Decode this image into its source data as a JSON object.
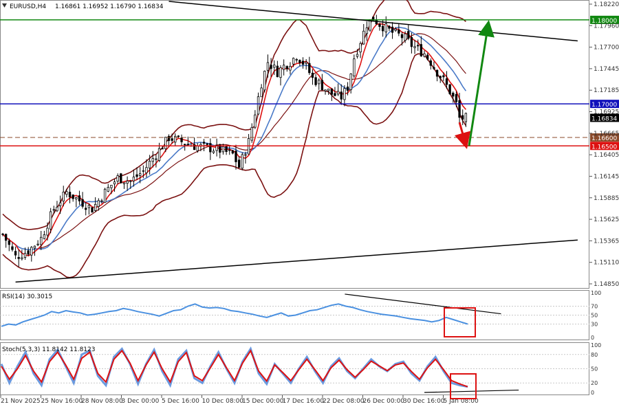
{
  "header": {
    "symbol": "EURUSD,H4",
    "ohlc": "1.16861 1.16952 1.16790 1.16834"
  },
  "colors": {
    "candle": "#000000",
    "bollinger": "#7a1010",
    "ma_fast": "#dd1111",
    "ma_slow": "#4a7ac8",
    "level_green": "#118811",
    "level_blue": "#1111bb",
    "level_red": "#dd1111",
    "level_dashed": "#8a4a2a",
    "rsi_line": "#4a90e0",
    "stoch_main": "#6a9ae0",
    "stoch_signal": "#dd1111",
    "box": "#dd1111",
    "arrow_up": "#118811",
    "arrow_down": "#dd1111",
    "trendline": "#000000"
  },
  "chart_data": [
    {
      "type": "candlestick",
      "pane": "price",
      "ylim": [
        1.1485,
        1.1822
      ],
      "price_axis_ticks": [
        "1.18220",
        "1.17960",
        "1.17700",
        "1.17445",
        "1.17185",
        "1.16925",
        "1.16665",
        "1.16405",
        "1.16145",
        "1.15885",
        "1.15625",
        "1.15365",
        "1.15110",
        "1.14850"
      ],
      "x_ticks": [
        "21 Nov 2025",
        "25 Nov 16:00",
        "28 Nov 08:00",
        "3 Dec 00:00",
        "5 Dec 16:00",
        "10 Dec 08:00",
        "15 Dec 00:00",
        "17 Dec 16:00",
        "22 Dec 08:00",
        "26 Dec 00:00",
        "30 Dec 16:00",
        "5 Jan 08:00"
      ],
      "horizontal_levels": [
        {
          "price": 1.18,
          "label": "1.18000",
          "style": "green"
        },
        {
          "price": 1.17,
          "label": "1.17000",
          "style": "blue"
        },
        {
          "price": 1.16834,
          "label": "1.16834",
          "style": "current"
        },
        {
          "price": 1.166,
          "label": "1.16600",
          "style": "dashed"
        },
        {
          "price": 1.165,
          "label": "1.16500",
          "style": "red"
        }
      ],
      "close_path": [
        [
          0,
          1.1545
        ],
        [
          4,
          1.1518
        ],
        [
          8,
          1.1525
        ],
        [
          12,
          1.154
        ],
        [
          16,
          1.1575
        ],
        [
          20,
          1.1595
        ],
        [
          24,
          1.1585
        ],
        [
          28,
          1.1575
        ],
        [
          32,
          1.1595
        ],
        [
          36,
          1.1612
        ],
        [
          40,
          1.1608
        ],
        [
          44,
          1.162
        ],
        [
          48,
          1.164
        ],
        [
          52,
          1.166
        ],
        [
          56,
          1.1655
        ],
        [
          60,
          1.165
        ],
        [
          64,
          1.1648
        ],
        [
          68,
          1.1645
        ],
        [
          72,
          1.164
        ],
        [
          74,
          1.1625
        ],
        [
          77,
          1.1655
        ],
        [
          79,
          1.169
        ],
        [
          81,
          1.1725
        ],
        [
          83,
          1.175
        ],
        [
          86,
          1.1738
        ],
        [
          88,
          1.1745
        ],
        [
          90,
          1.175
        ],
        [
          92,
          1.1758
        ],
        [
          95,
          1.1745
        ],
        [
          97,
          1.173
        ],
        [
          99,
          1.1725
        ],
        [
          101,
          1.1718
        ],
        [
          103,
          1.1712
        ],
        [
          106,
          1.1708
        ],
        [
          108,
          1.172
        ],
        [
          110,
          1.1755
        ],
        [
          112,
          1.1775
        ],
        [
          114,
          1.1795
        ],
        [
          116,
          1.1802
        ],
        [
          118,
          1.1795
        ],
        [
          120,
          1.179
        ],
        [
          122,
          1.1785
        ],
        [
          124,
          1.1782
        ],
        [
          126,
          1.1778
        ],
        [
          128,
          1.177
        ],
        [
          130,
          1.1765
        ],
        [
          132,
          1.176
        ],
        [
          134,
          1.175
        ],
        [
          136,
          1.1738
        ],
        [
          138,
          1.1728
        ],
        [
          140,
          1.1715
        ],
        [
          142,
          1.17
        ],
        [
          143,
          1.1683
        ]
      ],
      "trendlines": [
        {
          "from": [
            52,
            1.1822
          ],
          "to": [
            180,
            1.1775
          ]
        },
        {
          "from": [
            4,
            1.1488
          ],
          "to": [
            180,
            1.1538
          ]
        }
      ],
      "annotations": [
        {
          "type": "arrow",
          "color": "green",
          "from": [
            146,
            1.165
          ],
          "to": [
            152,
            1.1795
          ]
        },
        {
          "type": "arrow",
          "color": "red",
          "from": [
            143,
            1.1678
          ],
          "to": [
            145,
            1.1651
          ]
        }
      ]
    },
    {
      "type": "line",
      "pane": "rsi",
      "title": "RSI(14) 30.3015",
      "ylim": [
        0,
        100
      ],
      "y_ticks": [
        "100",
        "70",
        "50",
        "30",
        "0"
      ],
      "values": [
        25,
        30,
        28,
        35,
        40,
        45,
        50,
        58,
        55,
        60,
        57,
        55,
        50,
        52,
        55,
        58,
        60,
        65,
        62,
        58,
        55,
        52,
        48,
        54,
        60,
        62,
        70,
        75,
        68,
        66,
        67,
        65,
        60,
        58,
        55,
        52,
        48,
        45,
        50,
        55,
        48,
        50,
        55,
        60,
        62,
        67,
        72,
        75,
        70,
        67,
        62,
        58,
        55,
        52,
        50,
        48,
        45,
        42,
        40,
        38,
        35,
        38,
        45,
        40,
        35,
        30
      ],
      "trendlines": [
        {
          "from": [
            0.585,
            97
          ],
          "to": [
            0.85,
            53
          ]
        }
      ]
    },
    {
      "type": "line",
      "pane": "stochastic",
      "title": "Stoch(5,3,3) 11.8142 11.8123",
      "ylim": [
        0,
        100
      ],
      "y_ticks": [
        "100",
        "80",
        "50",
        "20",
        "0"
      ],
      "series": [
        {
          "name": "main",
          "values": [
            60,
            20,
            55,
            85,
            40,
            15,
            70,
            90,
            55,
            20,
            80,
            88,
            35,
            15,
            75,
            92,
            60,
            18,
            60,
            90,
            45,
            15,
            70,
            88,
            30,
            20,
            55,
            85,
            50,
            20,
            65,
            92,
            40,
            18,
            60,
            40,
            20,
            50,
            75,
            45,
            20,
            55,
            72,
            45,
            30,
            50,
            70,
            55,
            45,
            60,
            65,
            40,
            25,
            55,
            75,
            45,
            20,
            15,
            12
          ]
        },
        {
          "name": "signal",
          "values": [
            55,
            28,
            50,
            78,
            45,
            22,
            65,
            85,
            58,
            28,
            72,
            85,
            40,
            22,
            70,
            88,
            62,
            25,
            58,
            85,
            50,
            22,
            65,
            84,
            35,
            25,
            52,
            80,
            52,
            25,
            62,
            88,
            45,
            24,
            58,
            42,
            25,
            48,
            70,
            48,
            25,
            52,
            68,
            48,
            32,
            48,
            66,
            56,
            46,
            58,
            62,
            44,
            28,
            52,
            70,
            48,
            25,
            18,
            12
          ]
        }
      ],
      "trendlines": [
        {
          "from": [
            0.72,
            0
          ],
          "to": [
            0.88,
            5
          ]
        }
      ]
    }
  ]
}
